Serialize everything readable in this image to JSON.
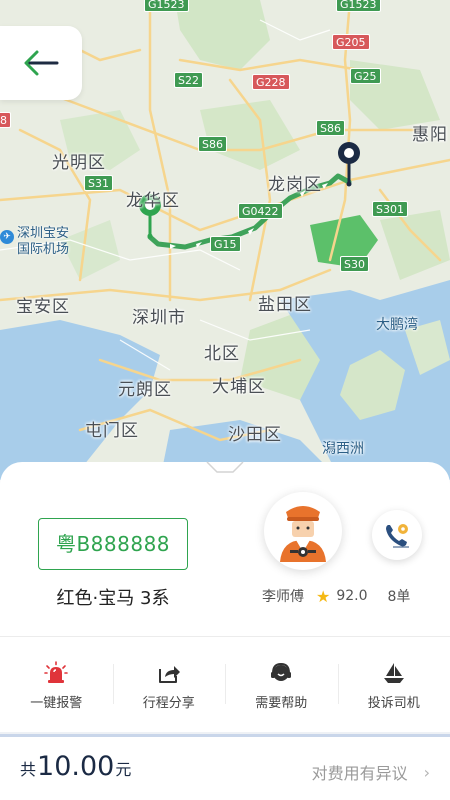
{
  "map": {
    "places": {
      "guangming": "光明区",
      "longhua": "龙华区",
      "longgang": "龙岗区",
      "huiyang": "惠阳",
      "baoan": "宝安区",
      "shenzhen": "深圳市",
      "yantian": "盐田区",
      "dapeng": "大鹏湾",
      "north": "北区",
      "yuenlong": "元朗区",
      "taipo": "大埔区",
      "tuenmun": "屯门区",
      "shatin": "沙田区",
      "tolo": "潟西洲"
    },
    "airport": {
      "line1": "深圳宝安",
      "line2": "国际机场",
      "icon": "airplane-icon"
    },
    "shields": {
      "g1523a": "G1523",
      "g1523b": "G1523",
      "g205": "G205",
      "g25": "G25",
      "s22": "S22",
      "g228": "G228",
      "s86a": "S86",
      "s86b": "S86",
      "s31": "S31",
      "g0422": "G0422",
      "s301": "S301",
      "s30": "S30",
      "g15": "G15",
      "edge": "8"
    },
    "route_color": "#3fa35a",
    "start_pin_color": "#2fa44f",
    "end_pin_color": "#1b2a44"
  },
  "nav": {
    "back_icon": "arrow-left-icon"
  },
  "vehicle": {
    "plate": "粤B888888",
    "description": "红色·宝马 3系"
  },
  "driver": {
    "name": "李师傅",
    "rating": "92.0",
    "orders": "8单",
    "avatar_icon": "driver-avatar-icon",
    "call_icon": "phone-call-icon"
  },
  "actions": [
    {
      "label": "一键报警",
      "icon": "alarm-icon"
    },
    {
      "label": "行程分享",
      "icon": "share-icon"
    },
    {
      "label": "需要帮助",
      "icon": "headset-icon"
    },
    {
      "label": "投诉司机",
      "icon": "complaint-icon"
    }
  ],
  "fare": {
    "prefix": "共",
    "amount": "10.00",
    "unit": "元",
    "dispute_label": "对费用有异议"
  },
  "colors": {
    "accent_green": "#2fa44f",
    "alarm_red": "#e0343a"
  }
}
